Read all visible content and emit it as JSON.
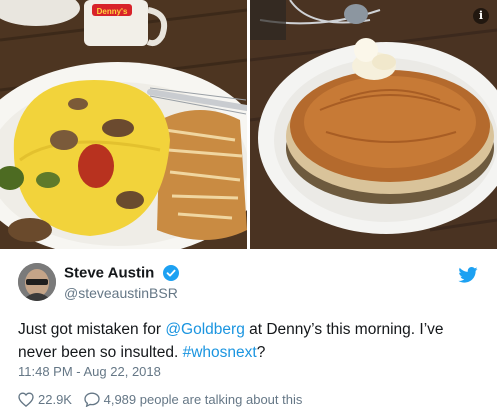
{
  "media": {
    "left_photo": {
      "mug_brand": "Denny's"
    },
    "right_photo": {}
  },
  "author": {
    "name": "Steve Austin",
    "handle": "@steveaustinBSR",
    "verified": true
  },
  "tweet": {
    "text_part1": "Just got mistaken for ",
    "mention": "@Goldberg",
    "text_part2": " at Denny’s this morning. I’ve never been so insulted. ",
    "hashtag": "#whosnext",
    "text_part3": "?"
  },
  "timestamp": "11:48 PM - Aug 22, 2018",
  "stats": {
    "likes": "22.9K",
    "talking": "4,989 people are talking about this"
  },
  "colors": {
    "link": "#1b95e0",
    "twitter_blue": "#1da1f2",
    "muted": "#657786",
    "text": "#14171a"
  },
  "icons": {
    "info": "info-icon",
    "verified": "verified-badge-icon",
    "twitter": "twitter-bird-icon",
    "like": "heart-icon",
    "reply": "speech-bubble-icon"
  }
}
